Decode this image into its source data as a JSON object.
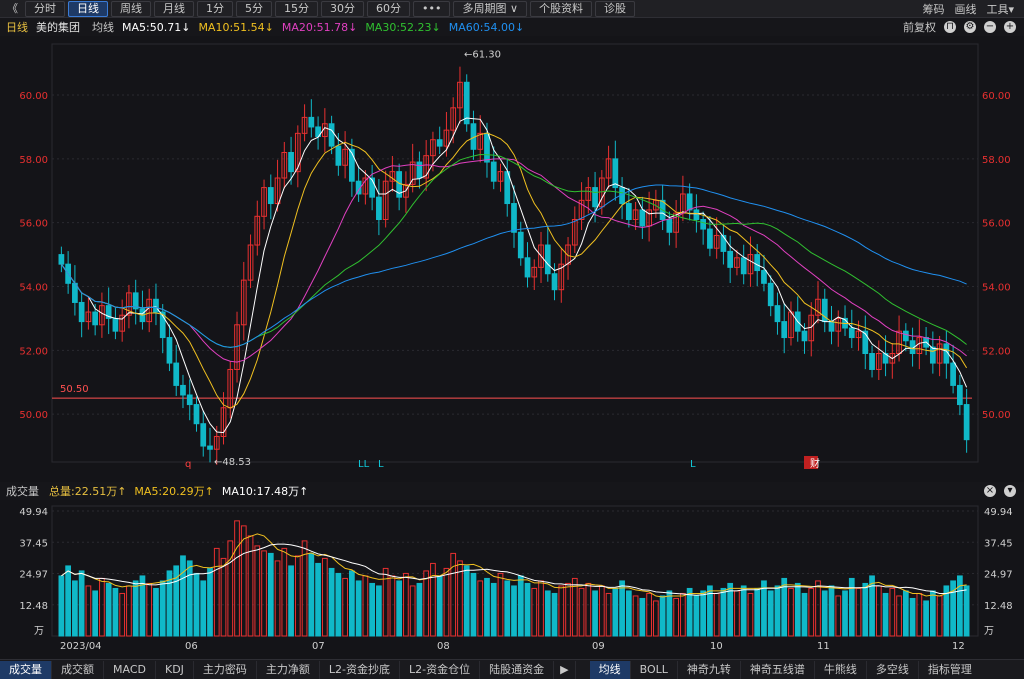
{
  "topbar": {
    "back_label": "《",
    "periods": [
      "分时",
      "日线",
      "周线",
      "月线",
      "1分",
      "5分",
      "15分",
      "30分",
      "60分",
      "•••"
    ],
    "active_period": "日线",
    "extra": [
      "多周期图 ∨",
      "个股资料",
      "诊股"
    ],
    "right_tools": [
      "筹码",
      "画线",
      "工具▾"
    ]
  },
  "info": {
    "period": "日线",
    "stock": "美的集团",
    "ma_label": "均线",
    "ma": [
      {
        "text": "MA5:50.71↓",
        "color": "#ffffff"
      },
      {
        "text": "MA10:51.54↓",
        "color": "#f0c020"
      },
      {
        "text": "MA20:51.78↓",
        "color": "#e040c0"
      },
      {
        "text": "MA30:52.23↓",
        "color": "#30c030"
      },
      {
        "text": "MA60:54.00↓",
        "color": "#2090f0"
      }
    ],
    "adjust": "前复权"
  },
  "chart_data": {
    "type": "candlestick",
    "price_axis": {
      "min": 48.5,
      "max": 61.6,
      "ticks": [
        "60.00",
        "58.00",
        "56.00",
        "54.00",
        "52.00",
        "50.00"
      ]
    },
    "x_labels": [
      "2023/04",
      "06",
      "07",
      "08",
      "09",
      "10",
      "11",
      "12"
    ],
    "high_mark": "61.30",
    "low_mark": "48.53",
    "ref_line": "50.50",
    "event_markers": [
      "q",
      "LL",
      "L",
      "L",
      "财"
    ],
    "closes": [
      54.7,
      54.1,
      53.5,
      52.9,
      53.2,
      52.8,
      53.4,
      53.0,
      52.6,
      53.1,
      53.8,
      53.3,
      52.9,
      53.6,
      53.2,
      52.4,
      51.6,
      50.9,
      50.6,
      50.3,
      49.7,
      49.0,
      48.9,
      49.3,
      50.2,
      51.4,
      52.8,
      54.2,
      55.3,
      56.2,
      57.1,
      56.6,
      57.4,
      58.2,
      57.6,
      58.8,
      59.3,
      59.0,
      58.7,
      59.1,
      58.4,
      57.8,
      58.3,
      57.3,
      56.9,
      57.4,
      56.8,
      56.1,
      57.3,
      57.6,
      56.8,
      57.2,
      57.9,
      57.4,
      58.1,
      58.6,
      58.4,
      58.9,
      59.6,
      60.4,
      59.1,
      58.3,
      58.8,
      57.9,
      57.3,
      57.6,
      56.6,
      55.7,
      54.9,
      54.3,
      54.6,
      55.3,
      54.4,
      53.9,
      54.7,
      55.3,
      56.1,
      56.7,
      57.1,
      56.5,
      57.4,
      58.0,
      57.1,
      56.6,
      56.1,
      56.4,
      55.9,
      56.4,
      56.7,
      56.1,
      55.7,
      56.3,
      56.9,
      56.4,
      56.1,
      55.8,
      55.2,
      55.6,
      55.1,
      54.6,
      54.9,
      54.4,
      55.0,
      54.5,
      54.1,
      53.4,
      52.9,
      52.4,
      53.2,
      52.6,
      52.3,
      53.1,
      53.6,
      52.9,
      52.6,
      53.0,
      52.7,
      52.4,
      52.6,
      51.9,
      51.4,
      51.9,
      51.6,
      51.9,
      52.6,
      52.3,
      51.9,
      52.4,
      52.1,
      51.6,
      52.2,
      51.6,
      50.9,
      50.3,
      49.2
    ],
    "volumes": [
      24,
      28,
      22,
      26,
      20,
      18,
      23,
      21,
      19,
      17,
      20,
      22,
      24,
      21,
      19,
      22,
      26,
      28,
      32,
      30,
      25,
      22,
      27,
      35,
      31,
      38,
      46,
      44,
      40,
      36,
      34,
      33,
      30,
      35,
      28,
      32,
      38,
      33,
      29,
      31,
      27,
      25,
      23,
      26,
      22,
      24,
      21,
      20,
      27,
      24,
      22,
      25,
      20,
      21,
      26,
      29,
      24,
      27,
      33,
      30,
      28,
      25,
      22,
      23,
      21,
      25,
      22,
      20,
      24,
      21,
      19,
      22,
      18,
      17,
      20,
      21,
      23,
      19,
      21,
      18,
      20,
      17,
      19,
      22,
      18,
      16,
      15,
      17,
      14,
      16,
      18,
      15,
      17,
      19,
      16,
      18,
      20,
      17,
      19,
      21,
      18,
      20,
      17,
      19,
      22,
      18,
      20,
      23,
      19,
      21,
      17,
      19,
      22,
      18,
      20,
      16,
      18,
      23,
      19,
      21,
      24,
      20,
      17,
      19,
      16,
      18,
      15,
      17,
      14,
      18,
      16,
      20,
      22,
      24,
      20
    ],
    "ma_lines": [
      {
        "name": "MA5",
        "color": "#ffffff",
        "offset": 0
      },
      {
        "name": "MA10",
        "color": "#f0c020",
        "offset": 1
      },
      {
        "name": "MA20",
        "color": "#e040c0",
        "offset": 2
      },
      {
        "name": "MA30",
        "color": "#30c030",
        "offset": 3
      },
      {
        "name": "MA60",
        "color": "#2090f0",
        "offset": 4
      }
    ]
  },
  "volume": {
    "title": "成交量",
    "total": "总量:22.51万↑",
    "ma5": "MA5:20.29万↑",
    "ma10": "MA10:17.48万↑",
    "ticks": [
      "49.94",
      "37.45",
      "24.97",
      "12.48"
    ],
    "unit": "万"
  },
  "bottom_tabs": {
    "left": [
      "成交量",
      "成交额",
      "MACD",
      "KDJ",
      "主力密码",
      "主力净额",
      "L2-资金抄底",
      "L2-资金仓位",
      "陆股通资金"
    ],
    "arrow": "▶",
    "right": [
      "均线",
      "BOLL",
      "神奇九转",
      "神奇五线谱",
      "牛熊线",
      "多空线",
      "指标管理"
    ],
    "active_left": "成交量",
    "active_right": "均线"
  },
  "colors": {
    "up": "#e83030",
    "down": "#10b8c8",
    "ref": "#ff5050",
    "grid": "#2a2a30",
    "axis_text": "#e83030"
  }
}
